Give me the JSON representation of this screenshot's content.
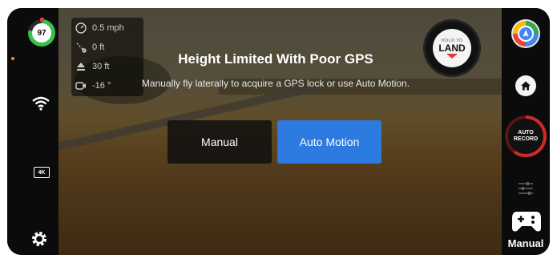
{
  "status": {
    "battery_percent": "97"
  },
  "telemetry": {
    "speed": "0.5 mph",
    "distance": "0 ft",
    "altitude": "30 ft",
    "tilt": "-16 °"
  },
  "hold_to_land": {
    "top_text": "HOLD TO",
    "main_text": "LAND"
  },
  "dialog": {
    "title": "Height Limited With Poor GPS",
    "message": "Manually fly laterally to acquire a GPS lock or use Auto Motion.",
    "manual_label": "Manual",
    "auto_motion_label": "Auto Motion"
  },
  "right_panel": {
    "auto_record_line1": "AUTO",
    "auto_record_line2": "RECORD",
    "mode_label": "Manual"
  },
  "left_panel": {
    "resolution_badge": "4K"
  },
  "colors": {
    "accent_blue": "#2d7be0",
    "battery_green": "#39c24a",
    "record_red": "#d02a2a"
  },
  "icons": [
    "battery-ring-icon",
    "wifi-icon",
    "camera-4k-icon",
    "gear-icon",
    "speedometer-icon",
    "distance-icon",
    "altitude-icon",
    "gimbal-icon",
    "maps-icon",
    "home-icon",
    "sliders-icon",
    "gamepad-icon"
  ]
}
